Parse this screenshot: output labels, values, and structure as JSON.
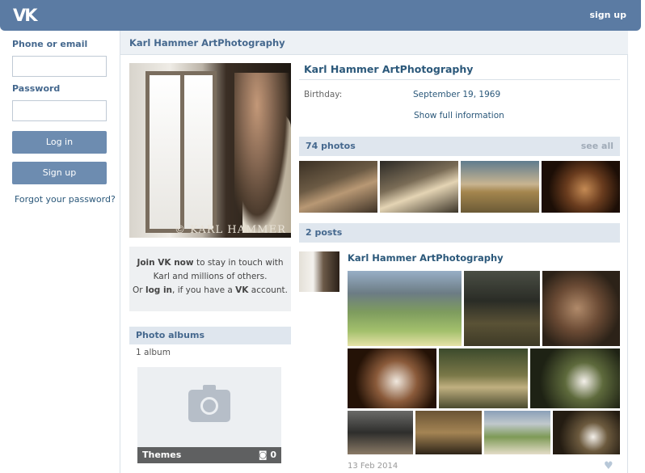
{
  "header": {
    "logo": "VK",
    "signup": "sign up"
  },
  "sidebar": {
    "phone_label": "Phone or email",
    "phone_value": "",
    "password_label": "Password",
    "password_value": "",
    "login_button": "Log in",
    "signup_button": "Sign up",
    "forgot_link": "Forgot your password?"
  },
  "page": {
    "title": "Karl Hammer ArtPhotography"
  },
  "profile": {
    "name": "Karl Hammer ArtPhotography",
    "avatar_watermark": "© KARL HAMMER",
    "birthday_label": "Birthday:",
    "birthday_value": "September 19, 1969",
    "show_full": "Show full information"
  },
  "join": {
    "join_vk_now": "Join VK now",
    "line1_rest": " to stay in touch with",
    "line2": "Karl and millions of others.",
    "line3_a": "Or ",
    "log_in": "log in",
    "line3_b": ", if you have a ",
    "vk": "VK",
    "line3_c": " account."
  },
  "albums": {
    "header": "Photo albums",
    "count": "1 album",
    "album_title": "Themes",
    "album_photo_count": "0"
  },
  "photos": {
    "header": "74 photos",
    "see_all": "see all"
  },
  "posts": {
    "header": "2 posts",
    "author": "Karl Hammer ArtPhotography",
    "date": "13 Feb 2014"
  }
}
